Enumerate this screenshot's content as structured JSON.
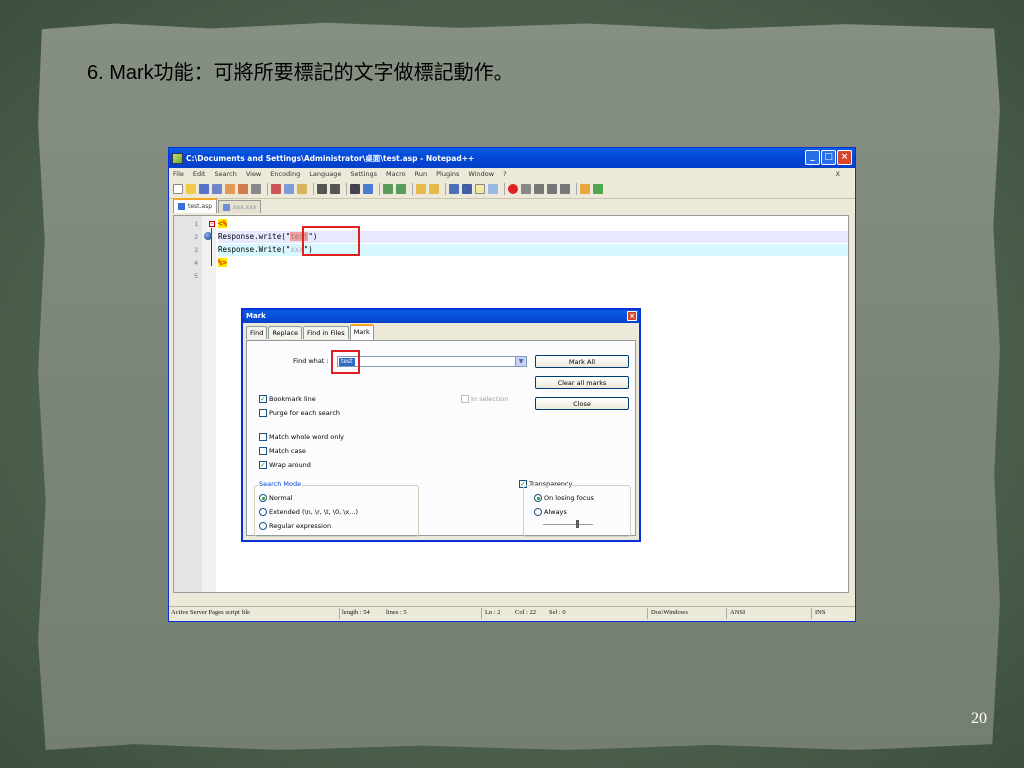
{
  "slide": {
    "title": "6. Mark功能：可將所要標記的文字做標記動作。",
    "page_number": "20"
  },
  "colors": {
    "background": "#4a5c4a",
    "paper": "#7b8679",
    "xp_blue": "#0449d8",
    "highlight_red": "#e02020"
  },
  "npp": {
    "title": "C:\\Documents and Settings\\Administrator\\桌面\\test.asp - Notepad++",
    "menu": [
      "File",
      "Edit",
      "Search",
      "View",
      "Encoding",
      "Language",
      "Settings",
      "Macro",
      "Run",
      "Plugins",
      "Window",
      "?"
    ],
    "menu_close": "X",
    "tabs": [
      {
        "label": "test.asp",
        "active": true
      },
      {
        "label": "xxx.xxx",
        "active": false
      }
    ],
    "lines": [
      {
        "num": "1",
        "open_tag": "<%"
      },
      {
        "num": "2",
        "prefix": "Response.write(\"",
        "marked": "test",
        "suffix": "\")"
      },
      {
        "num": "3",
        "prefix": "Response.Write(\"",
        "marked": "xxx",
        "suffix": "\")"
      },
      {
        "num": "4",
        "close_tag": "%>"
      },
      {
        "num": "5"
      }
    ],
    "status": {
      "filetype": "Active Server Pages script file",
      "length": "length : 54",
      "lines": "lines : 5",
      "ln": "Ln : 2",
      "col": "Col : 22",
      "sel": "Sel : 0",
      "eol": "Dos\\Windows",
      "encoding": "ANSI",
      "mode": "INS"
    }
  },
  "mark_dialog": {
    "title": "Mark",
    "tabs": [
      "Find",
      "Replace",
      "Find in Files",
      "Mark"
    ],
    "find_what_label": "Find what :",
    "find_what_value": "test",
    "buttons": {
      "mark_all": "Mark All",
      "clear_all_marks": "Clear all marks",
      "close": "Close"
    },
    "checks": {
      "bookmark_line": {
        "label": "Bookmark line",
        "checked": true
      },
      "purge": {
        "label": "Purge for each search",
        "checked": false
      },
      "in_selection": {
        "label": "In selection",
        "checked": false
      },
      "whole_word": {
        "label": "Match whole word only",
        "checked": false
      },
      "match_case": {
        "label": "Match case",
        "checked": false
      },
      "wrap_around": {
        "label": "Wrap around",
        "checked": true
      },
      "transparency": {
        "label": "Transparency",
        "checked": true
      }
    },
    "search_mode": {
      "title": "Search Mode",
      "normal": "Normal",
      "extended": "Extended (\\n, \\r, \\t, \\0, \\x...)",
      "regex": "Regular expression",
      "selected": "normal"
    },
    "transparency_mode": {
      "on_losing_focus": "On losing focus",
      "always": "Always",
      "selected": "on_losing_focus"
    }
  }
}
